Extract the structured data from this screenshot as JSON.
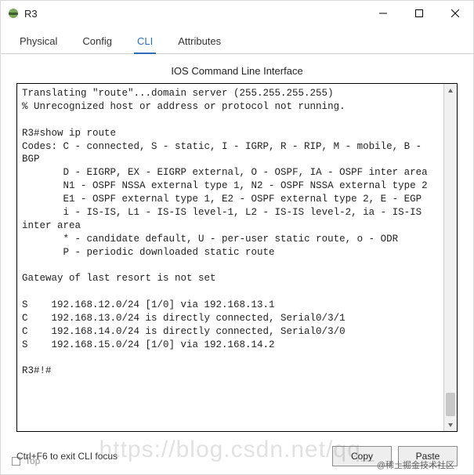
{
  "titlebar": {
    "title": "R3",
    "icon": "router-icon"
  },
  "tabs": [
    {
      "id": "physical",
      "label": "Physical",
      "active": false
    },
    {
      "id": "config",
      "label": "Config",
      "active": false
    },
    {
      "id": "cli",
      "label": "CLI",
      "active": true
    },
    {
      "id": "attributes",
      "label": "Attributes",
      "active": false
    }
  ],
  "pane_title": "IOS Command Line Interface",
  "terminal_output": "Translating \"route\"...domain server (255.255.255.255)\n% Unrecognized host or address or protocol not running.\n\nR3#show ip route\nCodes: C - connected, S - static, I - IGRP, R - RIP, M - mobile, B - BGP\n       D - EIGRP, EX - EIGRP external, O - OSPF, IA - OSPF inter area\n       N1 - OSPF NSSA external type 1, N2 - OSPF NSSA external type 2\n       E1 - OSPF external type 1, E2 - OSPF external type 2, E - EGP\n       i - IS-IS, L1 - IS-IS level-1, L2 - IS-IS level-2, ia - IS-IS inter area\n       * - candidate default, U - per-user static route, o - ODR\n       P - periodic downloaded static route\n\nGateway of last resort is not set\n\nS    192.168.12.0/24 [1/0] via 192.168.13.1\nC    192.168.13.0/24 is directly connected, Serial0/3/1\nC    192.168.14.0/24 is directly connected, Serial0/3/0\nS    192.168.15.0/24 [1/0] via 192.168.14.2\n\nR3#!#",
  "buttons": {
    "copy": "Copy",
    "paste": "Paste"
  },
  "hint": "Ctrl+F6 to exit CLI focus",
  "footer_checkbox_label": "Top",
  "watermark_main": "https://blog.csdn.net/qq_",
  "watermark_badge": "@稀土掘金技术社区"
}
